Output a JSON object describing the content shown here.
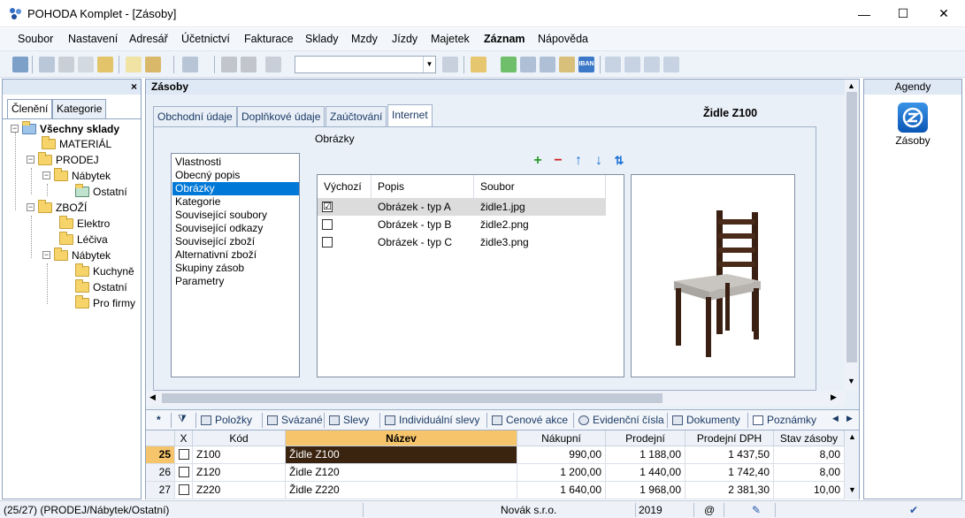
{
  "window": {
    "title": "POHODA Komplet - [Zásoby]",
    "controls": {
      "minimize": "—",
      "maximize": "☐",
      "close": "✕"
    }
  },
  "menu": [
    "Soubor",
    "Nastavení",
    "Adresář",
    "Účetnictví",
    "Fakturace",
    "Sklady",
    "Mzdy",
    "Jízdy",
    "Majetek",
    "Záznam",
    "Nápověda"
  ],
  "toolbar": {
    "combo_value": "",
    "iban": "IBAN"
  },
  "left_panel": {
    "close": "×",
    "tabs": [
      "Členění",
      "Kategorie"
    ],
    "tree": [
      {
        "label": "Všechny sklady"
      },
      {
        "label": "MATERIÁL"
      },
      {
        "label": "PRODEJ"
      },
      {
        "label": "Nábytek"
      },
      {
        "label": "Ostatní"
      },
      {
        "label": "ZBOŽÍ"
      },
      {
        "label": "Elektro"
      },
      {
        "label": "Léčiva"
      },
      {
        "label": "Nábytek"
      },
      {
        "label": "Kuchyně"
      },
      {
        "label": "Ostatní"
      },
      {
        "label": "Pro firmy"
      }
    ]
  },
  "main": {
    "title": "Zásoby",
    "tabs": [
      "Obchodní údaje",
      "Doplňkové údaje",
      "Zaúčtování",
      "Internet"
    ],
    "product_title": "Židle Z100",
    "section_label": "Obrázky",
    "sections": [
      "Vlastnosti",
      "Obecný popis",
      "Obrázky",
      "Kategorie",
      "Související soubory",
      "Související odkazy",
      "Související zboží",
      "Alternativní zboží",
      "Skupiny zásob",
      "Parametry"
    ],
    "image_table": {
      "headers": [
        "Výchozí",
        "Popis",
        "Soubor"
      ],
      "rows": [
        {
          "default": "☑",
          "popis": "Obrázek - typ A",
          "soubor": "židle1.jpg"
        },
        {
          "default": "",
          "popis": "Obrázek - typ B",
          "soubor": "židle2.png"
        },
        {
          "default": "",
          "popis": "Obrázek - typ C",
          "soubor": "židle3.png"
        }
      ]
    },
    "actions": {
      "add": "+",
      "remove": "−",
      "up": "↑",
      "down": "↓",
      "sort": "⇅"
    },
    "grid_tabs": [
      "Položky",
      "Svázané",
      "Slevy",
      "Individuální slevy",
      "Cenové akce",
      "Evidenční čísla",
      "Dokumenty",
      "Poznámky"
    ],
    "grid": {
      "row_marker": "*",
      "headers": [
        "X",
        "Kód",
        "Název",
        "Nákupní",
        "Prodejní",
        "Prodejní DPH",
        "Stav zásoby"
      ],
      "rows": [
        {
          "n": "25",
          "kod": "Z100",
          "nazev": "Židle Z100",
          "nakupni": "990,00",
          "prodejni": "1 188,00",
          "dph": "1 437,50",
          "stav": "8,00"
        },
        {
          "n": "26",
          "kod": "Z120",
          "nazev": "Židle Z120",
          "nakupni": "1 200,00",
          "prodejni": "1 440,00",
          "dph": "1 742,40",
          "stav": "8,00"
        },
        {
          "n": "27",
          "kod": "Z220",
          "nazev": "Židle Z220",
          "nakupni": "1 640,00",
          "prodejni": "1 968,00",
          "dph": "2 381,30",
          "stav": "10,00"
        }
      ]
    }
  },
  "right_panel": {
    "title": "Agendy",
    "item": "Zásoby"
  },
  "status": {
    "record": "(25/27) (PRODEJ/Nábytek/Ostatní)",
    "company": "Novák s.r.o.",
    "year": "2019",
    "at": "@"
  },
  "colors": {
    "selection": "#0078d7",
    "header_selected": "#f6c56b",
    "row_current": "#3a2410"
  }
}
